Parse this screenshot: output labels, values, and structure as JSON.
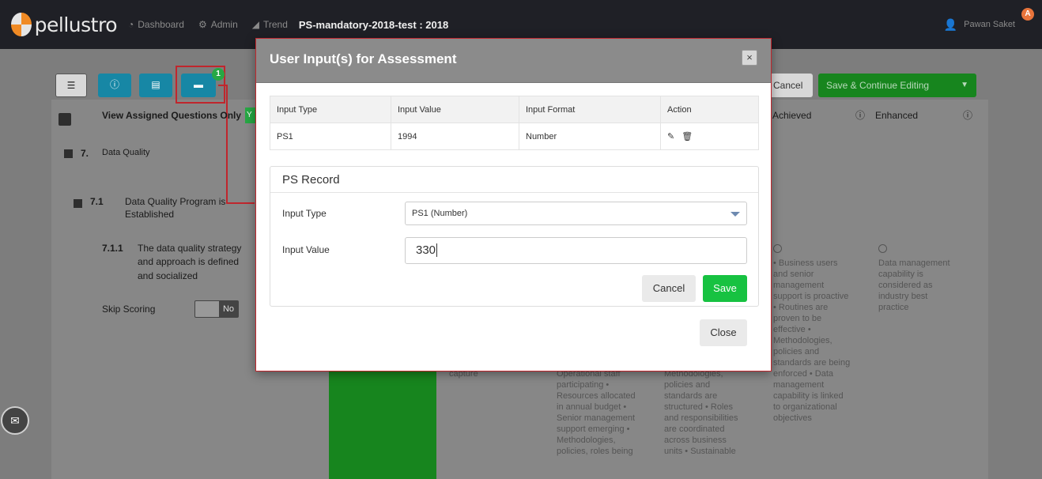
{
  "app": {
    "logo_text": "pellustro",
    "nav": {
      "dashboard": "Dashboard",
      "admin": "Admin",
      "trend": "Trend",
      "assessment_title": "PS-mandatory-2018-test : 2018"
    },
    "user": {
      "name": "Pawan Saket",
      "badge": "A"
    }
  },
  "toolbar": {
    "chat_badge": "1",
    "cancel_label": "Cancel",
    "save_continue_label": "Save & Continue Editing"
  },
  "grid": {
    "view_assigned_label": "View Assigned Questions Only",
    "view_assigned_tag": "Y",
    "achieved_header": "Achieved",
    "enhanced_header": "Enhanced"
  },
  "tree": {
    "section_num": "7.",
    "section_label": "Data Quality",
    "sub_num": "7.1",
    "sub_label_line1": "Data Quality Program is",
    "sub_label_line2": "Established",
    "q_num": "7.1.1",
    "q_line1": "The data quality strategy",
    "q_line2": "and approach is defined",
    "q_line3": "and socialized",
    "skip_scoring_label": "Skip Scoring",
    "skip_value": "No"
  },
  "levels": {
    "col1_text": "capture",
    "col2_lines": [
      "Operational staff",
      "participating •",
      "Resources allocated",
      "in annual budget •",
      "Senior management",
      "support emerging •",
      "Methodologies,",
      "policies, roles being"
    ],
    "col3_lines": [
      "Methodologies,",
      "policies and",
      "standards are",
      "structured • Roles",
      "and responsibilities",
      "are coordinated",
      "across business",
      "units • Sustainable"
    ],
    "achieved_lines": [
      "• Business users",
      "and senior",
      "management",
      "support is proactive",
      "• Routines are",
      "proven to be",
      "effective •",
      "Methodologies,",
      "policies and",
      "standards are being",
      "enforced • Data",
      "management",
      "capability is linked",
      "to organizational",
      "objectives"
    ],
    "enhanced_lines": [
      "Data management",
      "capability is",
      "considered as",
      "industry best",
      "practice"
    ]
  },
  "modal": {
    "title": "User Input(s) for Assessment",
    "close_x": "×",
    "table": {
      "headers": [
        "Input Type",
        "Input Value",
        "Input Format",
        "Action"
      ],
      "rows": [
        {
          "type": "PS1",
          "value": "1994",
          "format": "Number"
        }
      ]
    },
    "ps_record": {
      "title": "PS Record",
      "input_type_label": "Input Type",
      "input_type_value": "PS1 (Number)",
      "input_value_label": "Input Value",
      "input_value": "330",
      "cancel_label": "Cancel",
      "save_label": "Save"
    },
    "close_label": "Close"
  },
  "icons": {
    "edit": "pencil-icon",
    "delete": "trash-icon",
    "mail": "envelope-icon"
  }
}
